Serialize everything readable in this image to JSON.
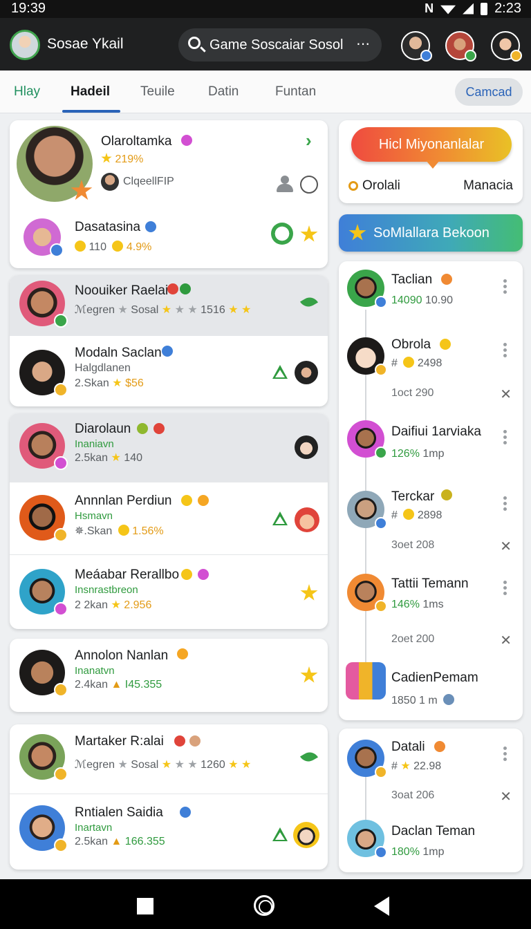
{
  "status_bar": {
    "time": "19:39",
    "clock_right": "2:23"
  },
  "header": {
    "app_name": "Sosae Ykail",
    "search_text": "Game Soscaiar Sosol",
    "more_label": "⋯"
  },
  "tabs": [
    "Hlay",
    "Hadeil",
    "Teuile",
    "Datin",
    "Funtan"
  ],
  "cancel_label": "Camcad",
  "featured": {
    "name": "Olaroltamka",
    "stat": "219%",
    "sub": "ClqeellFIP",
    "second_name": "Dasatasina",
    "second_stat_a": "110",
    "second_stat_b": "4.9%"
  },
  "group_a": [
    {
      "name": "Noouiker Raelai",
      "sub": "ℳegren",
      "tag": "Sosal",
      "value": "1516"
    },
    {
      "name": "Modaln Saclan",
      "sub": "Halgdlanen",
      "count": "2.Skan",
      "value": "$56"
    }
  ],
  "group_b": [
    {
      "name": "Diarolaun",
      "sub": "Inaniavn",
      "count": "2.5kan",
      "value": "140"
    },
    {
      "name": "Annnlan Perdiun",
      "sub": "Hsmavn",
      "count": "✵.Skan",
      "value": "1.56%"
    },
    {
      "name": "Meáabar Rerallbo",
      "sub": "Insnrastbreon",
      "count": "2 2kan",
      "value": "2.956"
    }
  ],
  "group_c": {
    "name": "Annolon Nanlan",
    "sub": "Inanatvn",
    "count": "2.4kan",
    "value": "I45.355"
  },
  "group_d": [
    {
      "name": "Martaker R:alai",
      "sub": "ℳegren",
      "tag": "Sosal",
      "value": "1260"
    },
    {
      "name": "Rntialen Saidia",
      "sub": "Inartavn",
      "count": "2.5kan",
      "value": "166.355"
    }
  ],
  "promo": {
    "pill": "Hicl Miyonanlalar",
    "left": "Orolali",
    "right": "Manacia"
  },
  "bloom_label": "SoMlallara Bekoon",
  "right_list": [
    {
      "name": "Taclian",
      "sub_a": "14090",
      "sub_b": "10.90"
    },
    {
      "name": "Obrola",
      "sub_a": "#",
      "sub_b": "2498",
      "time": "1oct 290"
    },
    {
      "name": "Daifiui 1arviaka",
      "sub_a": "126%",
      "sub_b": "1mp"
    },
    {
      "name": "Terckar",
      "sub_a": "#",
      "sub_b": "2898",
      "time": "3oet 208"
    },
    {
      "name": "Tattii Temann",
      "sub_a": "146%",
      "sub_b": "1ms",
      "time": "2oet 200"
    },
    {
      "name": "CadienPemam",
      "sub_a": "1850 1 m"
    }
  ],
  "right_bottom": [
    {
      "name": "Datali",
      "sub_a": "#",
      "sub_b": "22.98",
      "time": "3oat 206"
    },
    {
      "name": "Daclan Teman",
      "sub_a": "180%",
      "sub_b": "1mp"
    }
  ],
  "colors": {
    "accent": "#2a63b8",
    "green": "#2f9a3e",
    "gold": "#e39b16",
    "header_bg": "#1f2021"
  }
}
